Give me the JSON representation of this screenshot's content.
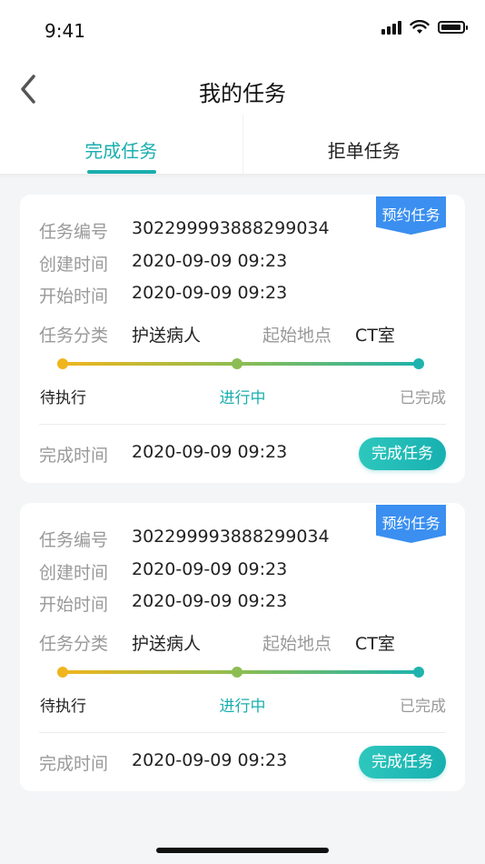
{
  "status_bar": {
    "time": "9:41"
  },
  "nav": {
    "title": "我的任务"
  },
  "tabs": [
    {
      "label": "完成任务",
      "active": true
    },
    {
      "label": "拒单任务",
      "active": false
    }
  ],
  "labels": {
    "task_no": "任务编号",
    "created": "创建时间",
    "started": "开始时间",
    "category": "任务分类",
    "origin": "起始地点",
    "completed": "完成时间"
  },
  "steps": [
    "待执行",
    "进行中",
    "已完成"
  ],
  "tasks": [
    {
      "tag": "预约任务",
      "task_no": "302299993888299034",
      "created": "2020-09-09 09:23",
      "started": "2020-09-09 09:23",
      "category": "护送病人",
      "origin": "CT室",
      "completed": "2020-09-09 09:23",
      "button": "完成任务"
    },
    {
      "tag": "预约任务",
      "task_no": "302299993888299034",
      "created": "2020-09-09 09:23",
      "started": "2020-09-09 09:23",
      "category": "护送病人",
      "origin": "CT室",
      "completed": "2020-09-09 09:23",
      "button": "完成任务"
    }
  ],
  "colors": {
    "accent": "#1aaeae",
    "tag": "#3a8ff0",
    "pending": "#f0b51e",
    "progress": "#8cbd52"
  }
}
